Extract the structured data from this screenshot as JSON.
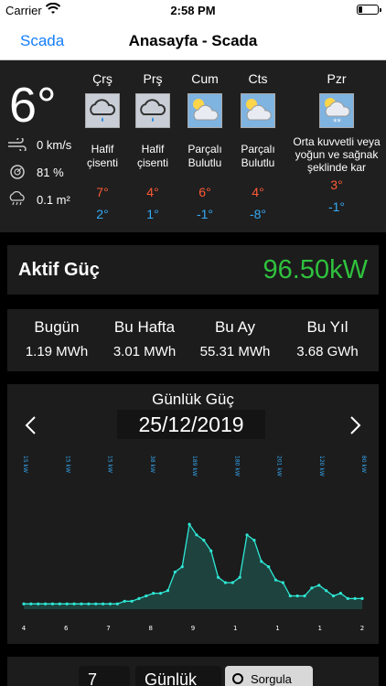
{
  "status": {
    "carrier": "Carrier",
    "time": "2:58 PM"
  },
  "nav": {
    "back": "Scada",
    "title": "Anasayfa - Scada"
  },
  "weather": {
    "current_temp": "6°",
    "wind": "0 km/s",
    "humidity": "81 %",
    "rain": "0.1 m²",
    "days": [
      {
        "name": "Çrş",
        "desc": "Hafif çisenti",
        "hi": "7°",
        "lo": "2°",
        "icon": "rain-cloud-icon"
      },
      {
        "name": "Prş",
        "desc": "Hafif çisenti",
        "hi": "4°",
        "lo": "1°",
        "icon": "rain-cloud-icon"
      },
      {
        "name": "Cum",
        "desc": "Parçalı Bulutlu",
        "hi": "6°",
        "lo": "-1°",
        "icon": "partly-cloudy-icon"
      },
      {
        "name": "Cts",
        "desc": "Parçalı Bulutlu",
        "hi": "4°",
        "lo": "-8°",
        "icon": "partly-cloudy-icon"
      },
      {
        "name": "Pzr",
        "desc": "Orta kuvvetli veya yoğun ve sağnak şeklinde kar",
        "hi": "3°",
        "lo": "-1°",
        "icon": "snow-cloud-icon"
      }
    ]
  },
  "power": {
    "label": "Aktif Güç",
    "value": "96.50kW",
    "color": "#2fc23d"
  },
  "stats": [
    {
      "key": "Bugün",
      "value": "1.19 MWh"
    },
    {
      "key": "Bu Hafta",
      "value": "3.01 MWh"
    },
    {
      "key": "Bu Ay",
      "value": "55.31 MWh"
    },
    {
      "key": "Bu Yıl",
      "value": "3.68 GWh"
    }
  ],
  "chart": {
    "title": "Günlük Güç",
    "date": "25/12/2019"
  },
  "chart_data": {
    "type": "area",
    "line_color": "#2ee8d6",
    "top_labels": [
      "15 kW",
      "15 kW",
      "15 kW",
      "38 kW",
      "189 kW",
      "180 kW",
      "201 kW",
      "120 kW",
      "80 kW"
    ],
    "x_ticks": [
      "4",
      "6",
      "7",
      "8",
      "9",
      "1",
      "1",
      "1",
      "2"
    ],
    "values": [
      2,
      2,
      2,
      2,
      2,
      2,
      2,
      2,
      2,
      2,
      2,
      2,
      2,
      2,
      3,
      3,
      4,
      5,
      6,
      6,
      7,
      14,
      16,
      32,
      28,
      26,
      22,
      12,
      10,
      10,
      12,
      28,
      26,
      18,
      16,
      11,
      10,
      5,
      5,
      5,
      8,
      9,
      7,
      5,
      6,
      4,
      4,
      4
    ]
  },
  "bottom": {
    "count": "7",
    "period": "Günlük",
    "query": "Sorgula"
  }
}
